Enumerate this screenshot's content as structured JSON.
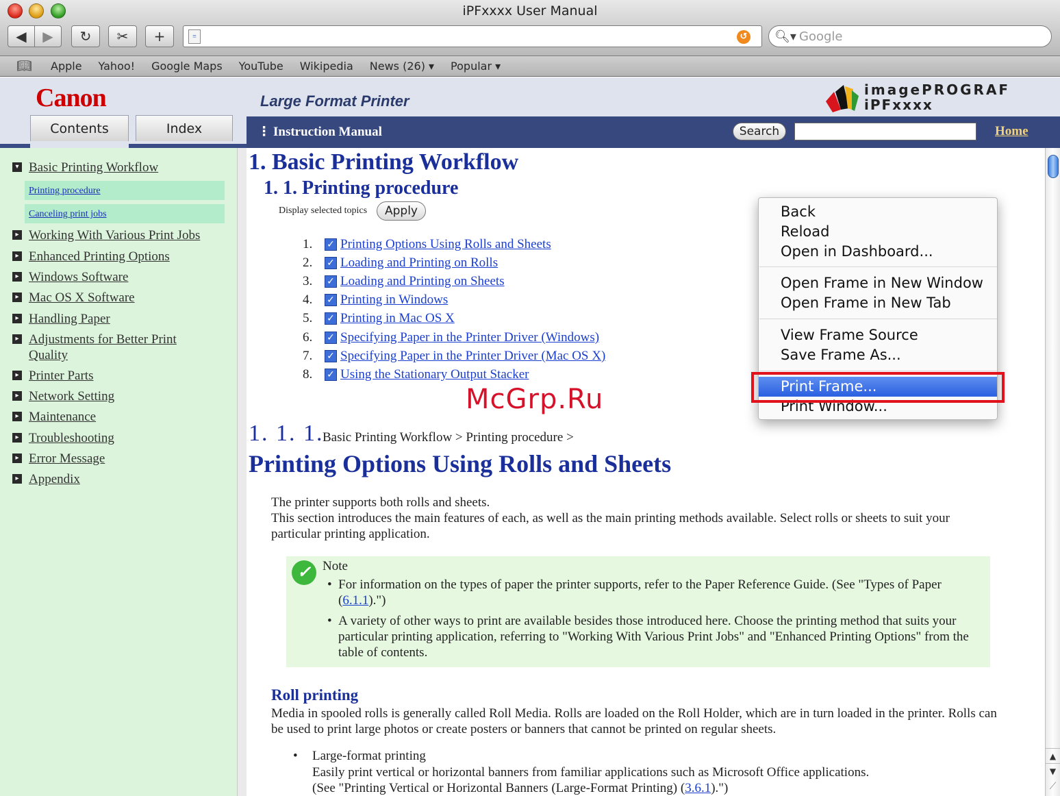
{
  "window": {
    "title": "iPFxxxx User Manual"
  },
  "toolbar": {
    "back_icon": "◀",
    "forward_icon": "▶",
    "reload_icon": "↻",
    "snap_icon": "✂",
    "add_icon": "+",
    "search_placeholder": "Google"
  },
  "bookmarks": [
    "Apple",
    "Yahoo!",
    "Google Maps",
    "YouTube",
    "Wikipedia",
    "News (26) ▾",
    "Popular ▾"
  ],
  "header": {
    "logo": "Canon",
    "product_line": "Large Format Printer",
    "brand_line1": "imagePROGRAF",
    "brand_line2": "iPFxxxx",
    "tabs": {
      "contents": "Contents",
      "index": "Index"
    },
    "nav_title": "Instruction Manual",
    "search_label": "Search",
    "home_label": "Home"
  },
  "toc": {
    "items": [
      "Basic Printing Workflow",
      "Working With Various Print Jobs",
      "Enhanced Printing Options",
      "Windows Software",
      "Mac OS X Software",
      "Handling Paper",
      "Adjustments for Better Print Quality",
      "Printer Parts",
      "Network Setting",
      "Maintenance",
      "Troubleshooting",
      "Error Message",
      "Appendix"
    ],
    "sub_items": [
      "Printing procedure",
      "Canceling print jobs"
    ]
  },
  "content": {
    "h1": "1. Basic Printing Workflow",
    "h2": "1. 1. Printing procedure",
    "display_topics": "Display selected topics",
    "apply_label": "Apply",
    "topics": [
      {
        "num": "1.",
        "label": "Printing Options Using Rolls and Sheets"
      },
      {
        "num": "2.",
        "label": "Loading and Printing on Rolls"
      },
      {
        "num": "3.",
        "label": "Loading and Printing on Sheets"
      },
      {
        "num": "4.",
        "label": "Printing in Windows"
      },
      {
        "num": "5.",
        "label": "Printing in Mac OS X"
      },
      {
        "num": "6.",
        "label": "Specifying Paper in the Printer Driver (Windows)"
      },
      {
        "num": "7.",
        "label": "Specifying Paper in the Printer Driver (Mac OS X)"
      },
      {
        "num": "8.",
        "label": "Using the Stationary Output Stacker"
      }
    ],
    "section_number": "1. 1. 1.",
    "breadcrumb": "Basic Printing Workflow > Printing procedure >",
    "section_title": "Printing Options Using Rolls and Sheets",
    "intro1": "The printer supports both rolls and sheets.",
    "intro2": "This section introduces the main features of each, as well as the main printing methods available. Select rolls or sheets to suit your particular printing application.",
    "note_label": "Note",
    "note1_text": "For information on the types of paper the printer supports, refer to the Paper Reference Guide.  (See \"Types of Paper (",
    "note1_link": "6.1.1",
    "note1_end": ").\")",
    "note2": "A variety of other ways to print are available besides those introduced here. Choose the printing method that suits your particular printing application, referring to \"Working With Various Print Jobs\" and \"Enhanced Printing Options\" from the table of contents.",
    "roll_title": "Roll printing",
    "roll_text": "Media in spooled rolls is generally called Roll Media. Rolls are loaded on the Roll Holder, which are in turn loaded in the printer. Rolls can be used to print large photos or create posters or banners that cannot be printed on regular sheets.",
    "lf_title": "Large-format printing",
    "lf_desc1": "Easily print vertical or horizontal banners from familiar applications such as Microsoft Office applications.",
    "lf_desc2_start": "(See \"Printing Vertical or Horizontal Banners (Large-Format Printing) (",
    "lf_desc2_link": "3.6.1",
    "lf_desc2_end": ").\")"
  },
  "context_menu": {
    "items": [
      "Back",
      "Reload",
      "Open in Dashboard...",
      "Open Frame in New Window",
      "Open Frame in New Tab",
      "View Frame Source",
      "Save Frame As...",
      "Print Frame...",
      "Print Window..."
    ],
    "highlighted": "Print Frame..."
  },
  "watermark": "McGrp.Ru",
  "colors": {
    "toc_bg": "#dcf4dc",
    "nav_band": "#37487f",
    "link": "#1a3fd0",
    "heading": "#1a2f9a",
    "highlight_box": "#e2121c"
  }
}
